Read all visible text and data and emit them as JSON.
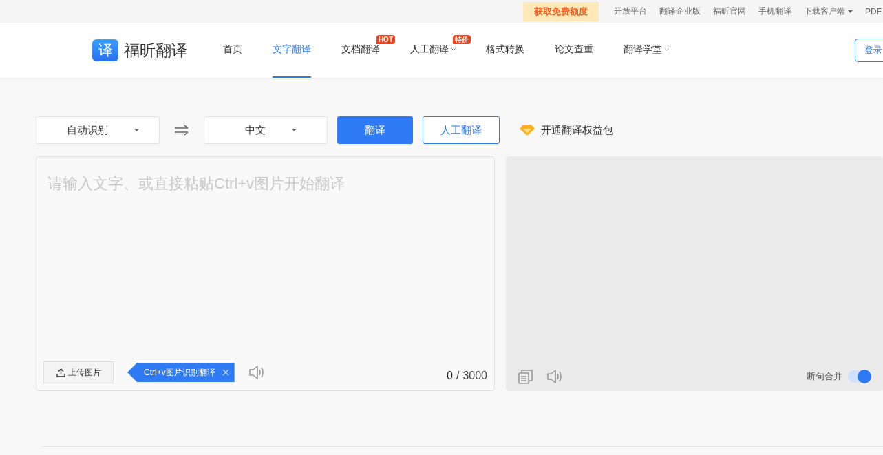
{
  "top_bar": {
    "promo": "获取免费额度",
    "links": [
      {
        "label": "开放平台",
        "dropdown": false
      },
      {
        "label": "翻译企业版",
        "dropdown": false
      },
      {
        "label": "福昕官网",
        "dropdown": false
      },
      {
        "label": "手机翻译",
        "dropdown": false
      },
      {
        "label": "下载客户端",
        "dropdown": true
      },
      {
        "label": "PDF",
        "dropdown": false
      }
    ]
  },
  "nav": {
    "logo_mark": "译",
    "logo_text": "福昕翻译",
    "items": [
      {
        "label": "首页",
        "selected": false,
        "dropdown": false
      },
      {
        "label": "文字翻译",
        "selected": true,
        "dropdown": false
      },
      {
        "label": "文档翻译",
        "selected": false,
        "dropdown": false,
        "badge": "HOT"
      },
      {
        "label": "人工翻译",
        "selected": false,
        "dropdown": true,
        "badge": "特价"
      },
      {
        "label": "格式转换",
        "selected": false,
        "dropdown": false
      },
      {
        "label": "论文查重",
        "selected": false,
        "dropdown": false
      },
      {
        "label": "翻译学堂",
        "selected": false,
        "dropdown": true
      }
    ],
    "login": "登录"
  },
  "toolbar": {
    "source_lang": "自动识别",
    "target_lang": "中文",
    "translate_button": "翻译",
    "human_button": "人工翻译",
    "benefit_link": "开通翻译权益包"
  },
  "input_panel": {
    "placeholder": "请输入文字、或直接粘贴Ctrl+v图片开始翻译",
    "upload_button": "上传图片",
    "tip": "Ctrl+v图片识别翻译",
    "count": "0",
    "separator": "/",
    "limit": "3000"
  },
  "output_panel": {
    "merge_label": "断句合并",
    "merge_on": true
  }
}
